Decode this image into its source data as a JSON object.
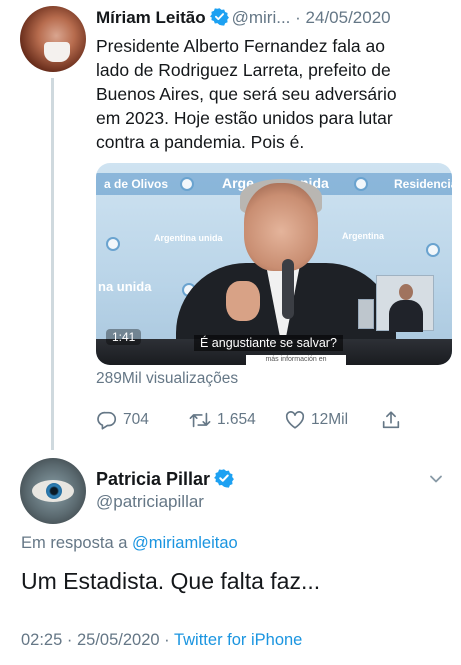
{
  "tweet": {
    "author_name": "Míriam Leitão",
    "handle": "@miri...",
    "separator": "·",
    "date": "24/05/2020",
    "text_lines": [
      "Presidente Alberto Fernandez fala ao",
      "lado de Rodriguez Larreta, prefeito de",
      "Buenos  Aires, que será seu adversário",
      "em 2023. Hoje estão unidos para lutar",
      "contra a pandemia. Pois é."
    ],
    "media": {
      "banner_words": [
        "a de Olivos",
        "Arge",
        "nida",
        "Residencia"
      ],
      "backdrop_words": [
        "Argentina unida",
        "Argentina",
        "na unida"
      ],
      "time_left": "1:41",
      "caption": "É angustiante se salvar?",
      "strip_text": "más información en"
    },
    "views": "289Mil visualizações",
    "actions": {
      "reply_count": "704",
      "retweet_count": "1.654",
      "like_count": "12Mil"
    }
  },
  "reply": {
    "author_name": "Patricia Pillar",
    "handle": "@patriciapillar",
    "reply_prefix": "Em resposta a",
    "reply_mention": "@miriamleitao",
    "text": "Um Estadista. Que falta faz...",
    "time": "02:25",
    "separator": "·",
    "date": "25/05/2020",
    "source": "Twitter for iPhone"
  },
  "colors": {
    "text": "#14171a",
    "muted": "#657786",
    "link": "#1b95e0",
    "verified": "#1da1f2",
    "thread_line": "#cfd9de"
  },
  "icons": [
    "verified-badge-icon",
    "reply-icon",
    "retweet-icon",
    "like-icon",
    "share-icon",
    "chevron-down-icon"
  ]
}
